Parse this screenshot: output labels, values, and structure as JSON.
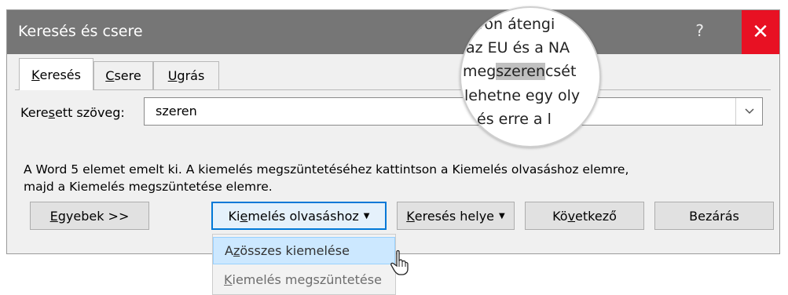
{
  "window": {
    "title": "Keresés és csere",
    "help_label": "?",
    "close_label": "✕"
  },
  "tabs": [
    {
      "label": "Keresés",
      "access_key": "K",
      "rest": "eresés",
      "active": true
    },
    {
      "label": "Csere",
      "access_key": "C",
      "rest": "sere",
      "active": false
    },
    {
      "label": "Ugrás",
      "access_key": "U",
      "rest": "grás",
      "active": false
    }
  ],
  "search": {
    "label": "Keresett szöveg:",
    "label_pre": "Kere",
    "label_key": "s",
    "label_post": "ett szöveg:",
    "value": "szeren"
  },
  "message": {
    "line1": "A Word 5 elemet emelt ki. A kiemelés megszüntetéséhez kattintson a Kiemelés olvasáshoz elemre,",
    "line2": "majd a Kiemelés megszüntetése elemre."
  },
  "buttons": {
    "more": {
      "label": "Egyebek >>",
      "key": "E",
      "rest": "gyebek >>"
    },
    "highlight": {
      "label": "Kiemelés olvasáshoz",
      "pre": "Ki",
      "key": "e",
      "rest": "melés olvasáshoz"
    },
    "find_in": {
      "label": "Keresés helye",
      "key": "K",
      "rest": "eresés helye"
    },
    "next": {
      "label": "Következő",
      "pre": "Kö",
      "key": "v",
      "rest": "etkező"
    },
    "close": {
      "label": "Bezárás"
    }
  },
  "dropdown_menu": [
    {
      "label": "Az összes kiemelése",
      "pre": "A",
      "key": "z",
      "rest": " összes kiemelése",
      "state": "hover"
    },
    {
      "label": "Kiemelés megszüntetése",
      "key": "K",
      "rest": "iemelés megszüntetése",
      "state": "disabled"
    }
  ],
  "magnifier": {
    "lines": [
      {
        "text": "ron átengi"
      },
      {
        "text": "az EU és a NA"
      },
      {
        "pre": "meg",
        "highlight": "szeren",
        "post": "csét"
      },
      {
        "text": "lehetne egy oly"
      },
      {
        "text": "és erre a l"
      }
    ]
  },
  "colors": {
    "titlebar": "#767676",
    "close_button": "#e81123",
    "focus_border": "#0078d7",
    "menu_hover": "#cce8ff",
    "search_highlight": "#c0c0c0"
  }
}
